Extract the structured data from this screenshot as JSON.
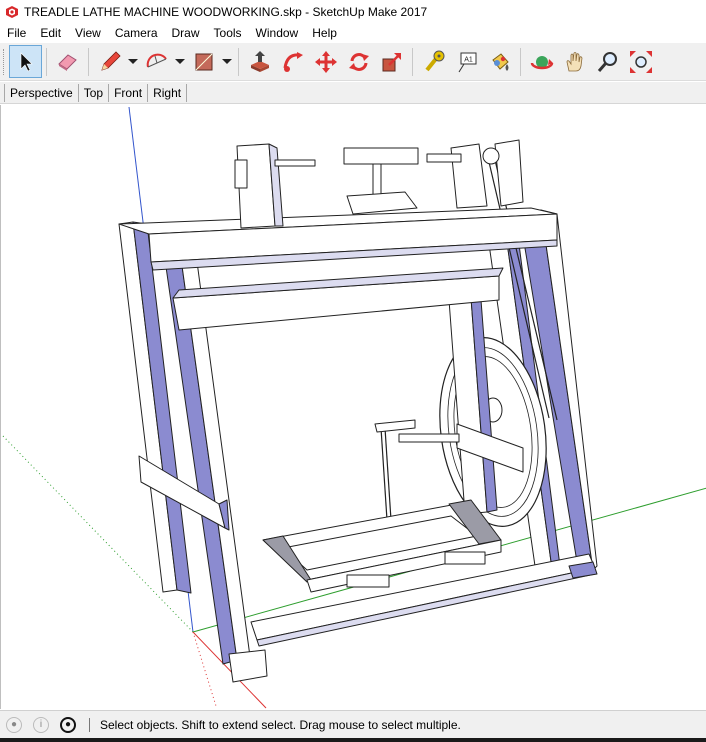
{
  "window": {
    "title": "TREADLE LATHE MACHINE WOODWORKING.skp - SketchUp Make 2017"
  },
  "menu": [
    "File",
    "Edit",
    "View",
    "Camera",
    "Draw",
    "Tools",
    "Window",
    "Help"
  ],
  "toolbar": {
    "tools": [
      "select-icon",
      "eraser-icon",
      "pencil-icon",
      "arc-icon",
      "rectangle-icon",
      "push-pull-icon",
      "follow-me-icon",
      "move-icon",
      "rotate-icon",
      "scale-icon",
      "tape-measure-icon",
      "text-icon",
      "paint-bucket-icon",
      "orbit-icon",
      "pan-icon",
      "zoom-icon",
      "zoom-extents-icon"
    ],
    "text_tool_label": "A1",
    "selected": "select-icon"
  },
  "views": [
    "Perspective",
    "Top",
    "Front",
    "Right"
  ],
  "status": {
    "message": "Select objects. Shift to extend select. Drag mouse to select multiple."
  },
  "colors": {
    "accent": "#cde4f7",
    "frame_face": "#8888cc",
    "wood_face": "#ffffff",
    "toolbar_bg": "#f0f0f0",
    "axis_green": "#2e9e2e",
    "axis_red": "#d33",
    "axis_blue": "#3355cc",
    "floor": "#9b9ba6"
  }
}
